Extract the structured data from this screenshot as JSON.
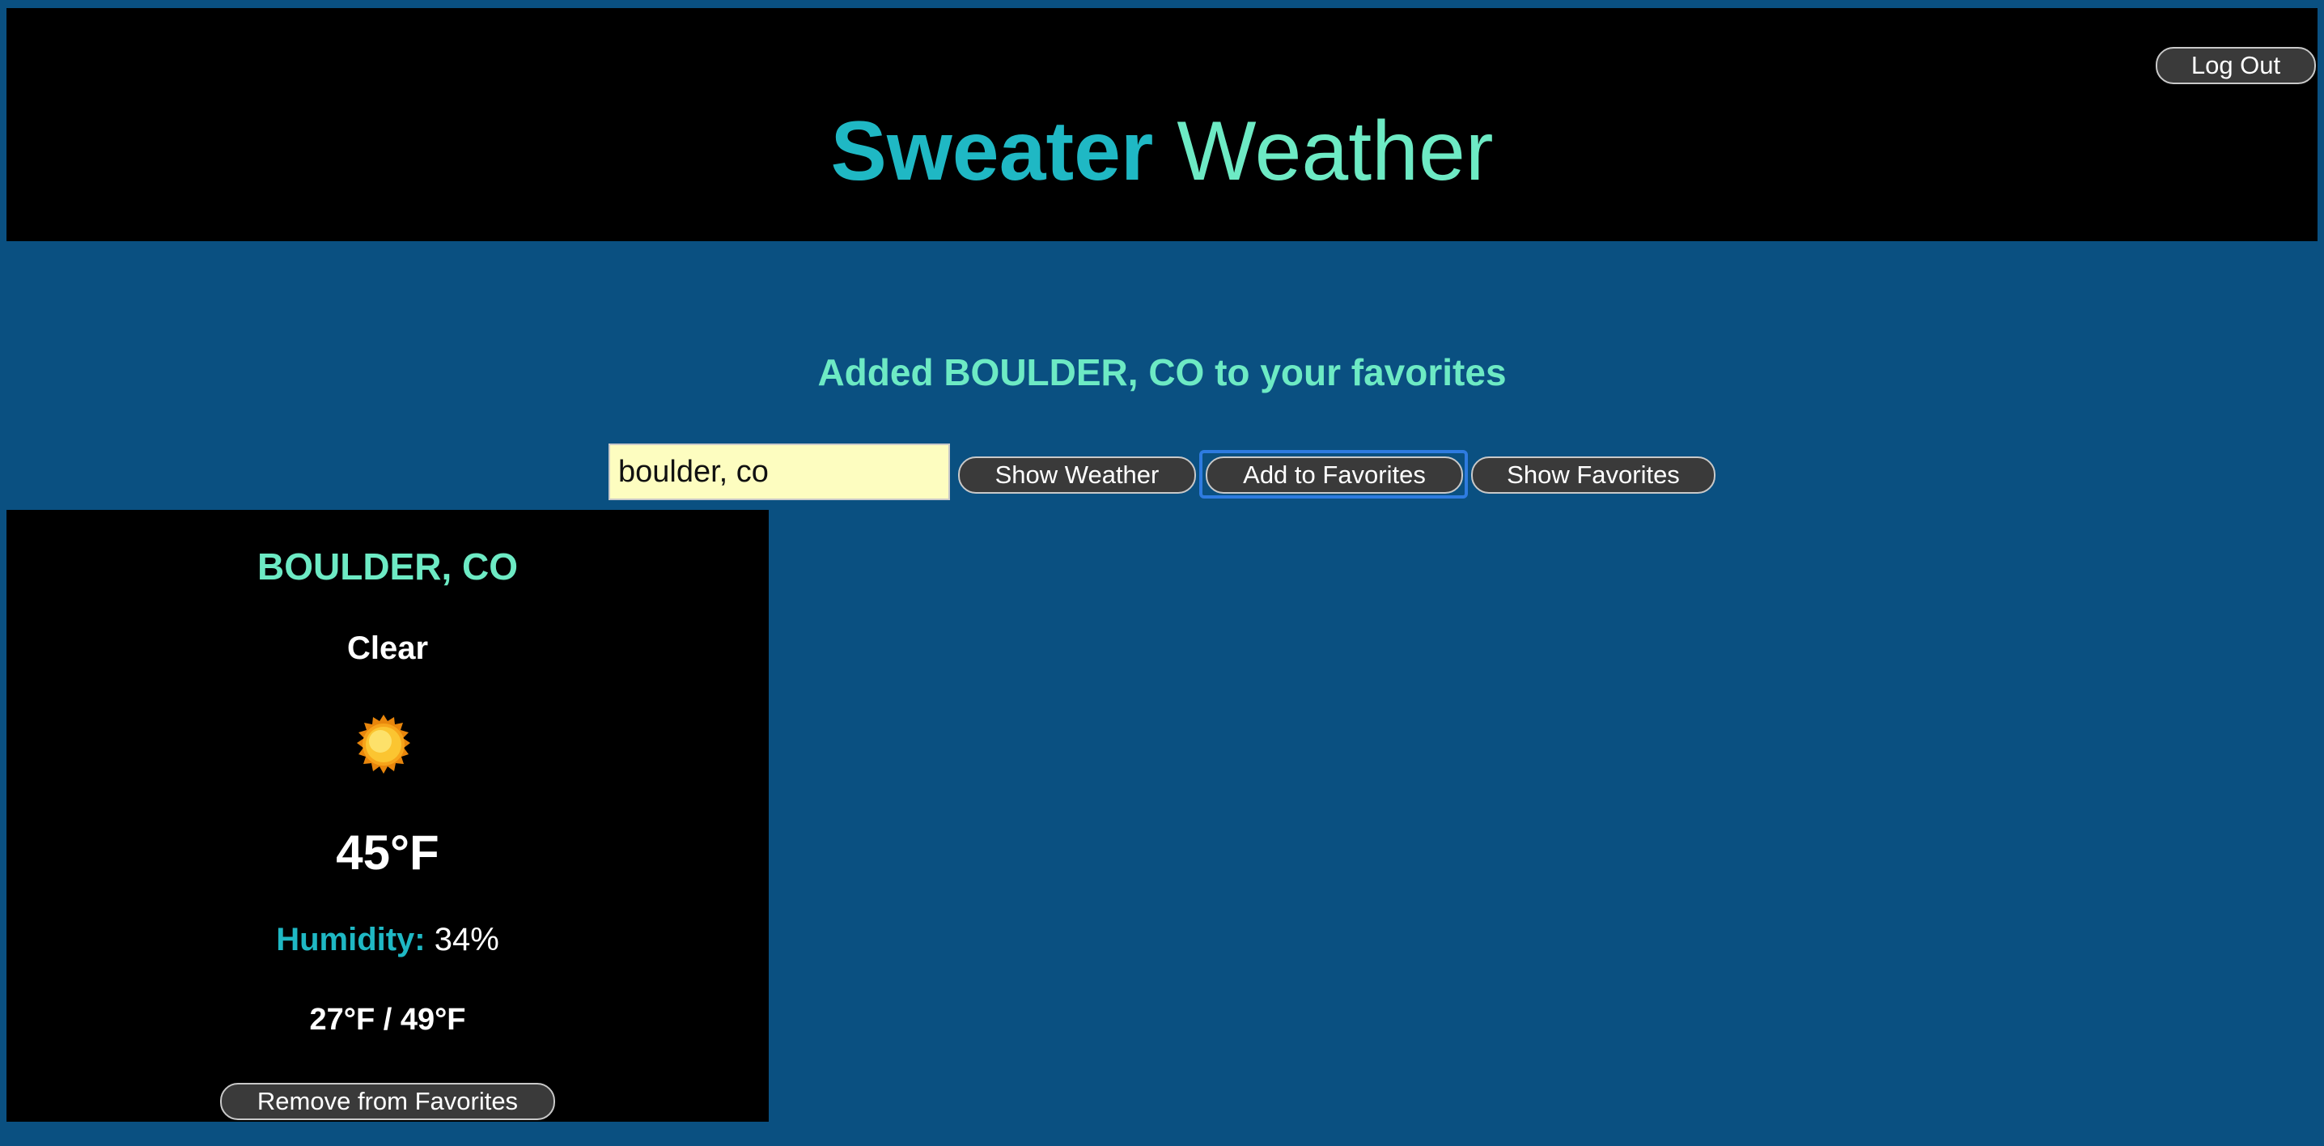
{
  "header": {
    "title_bold": "Sweater",
    "title_light": "Weather",
    "logout_label": "Log Out"
  },
  "message": "Added BOULDER, CO to your favorites",
  "search": {
    "value": "boulder, co",
    "show_weather_label": "Show Weather",
    "add_favorites_label": "Add to Favorites",
    "show_favorites_label": "Show Favorites"
  },
  "weather_card": {
    "city": "BOULDER, CO",
    "condition": "Clear",
    "icon": "sun-icon",
    "temperature": "45°F",
    "humidity_label": "Humidity:",
    "humidity_value": "34%",
    "low_high": "27°F / 49°F",
    "remove_label": "Remove from Favorites"
  },
  "colors": {
    "background": "#0a5081",
    "panel": "#000000",
    "accent_teal": "#1fb8c4",
    "accent_mint": "#6deac4",
    "input_bg": "#fdfdc0",
    "button_bg": "#3a3a3a",
    "focus_outline": "#2e7be0"
  }
}
